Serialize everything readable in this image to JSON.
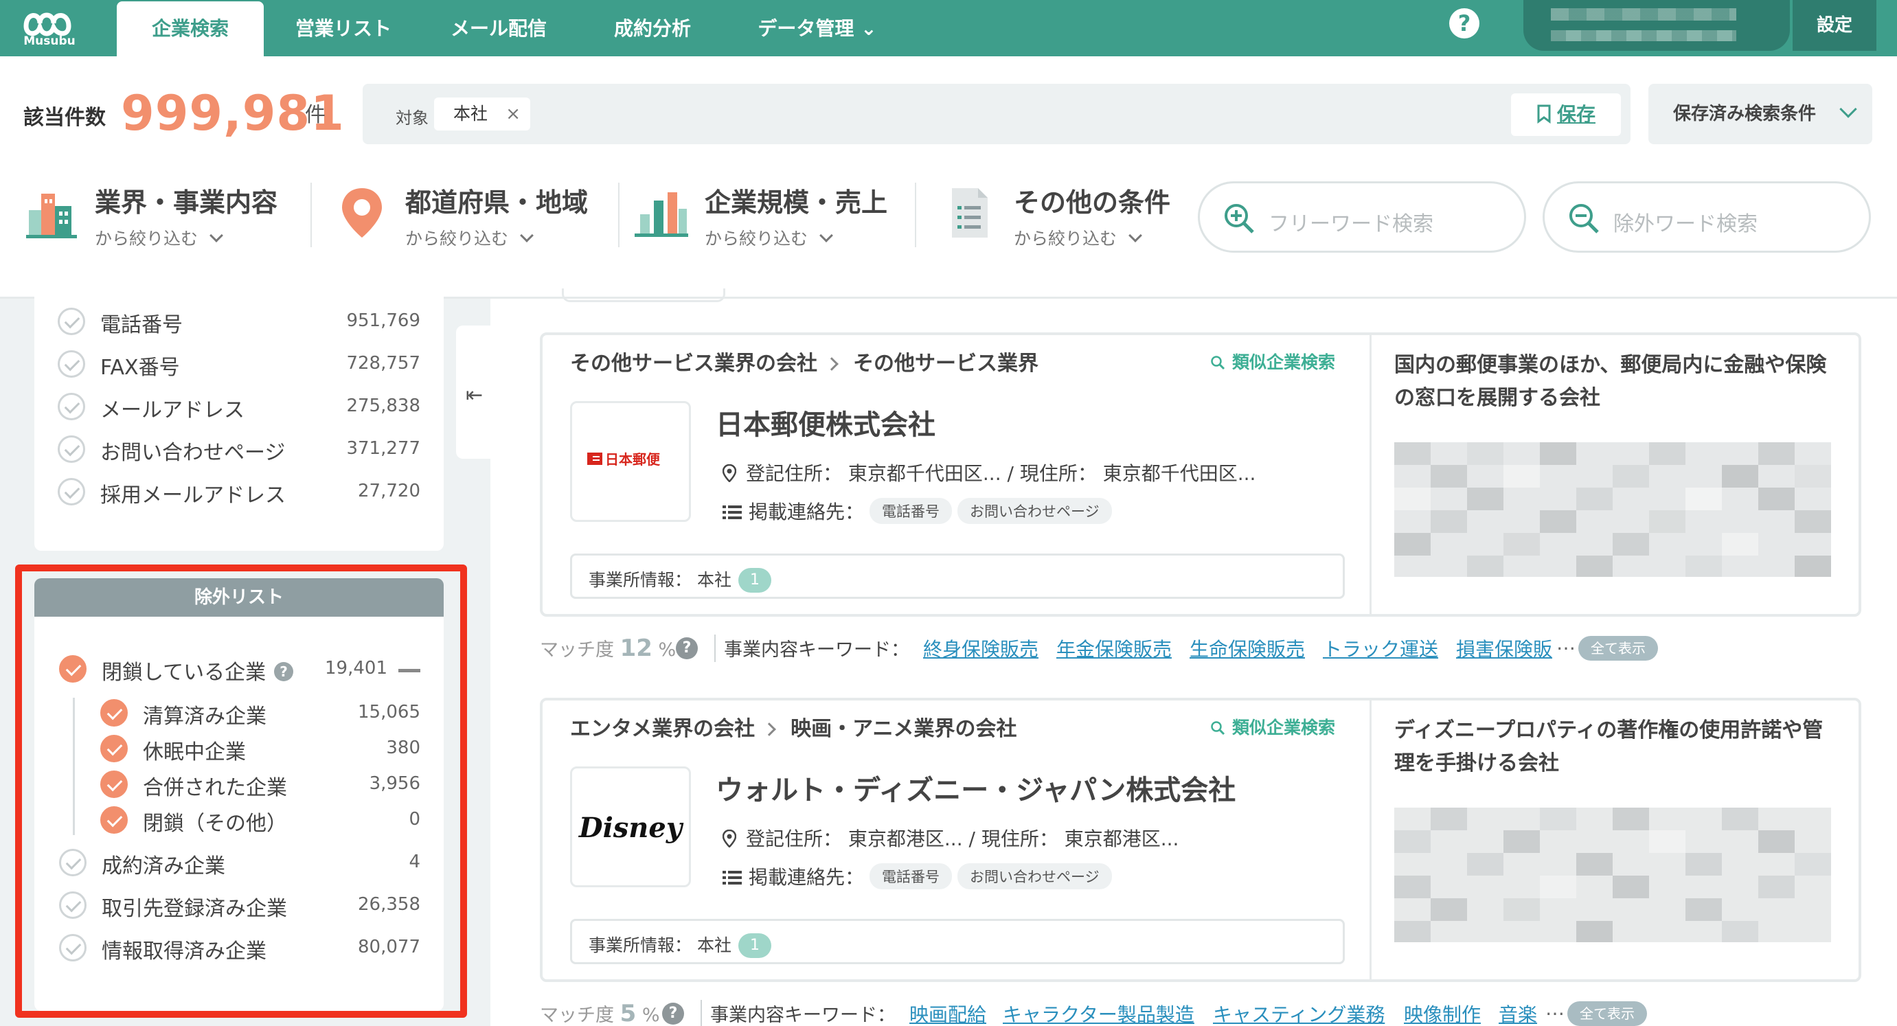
{
  "nav": {
    "logo_text": "Musubu",
    "tabs": [
      {
        "label": "企業検索",
        "active": true
      },
      {
        "label": "営業リスト"
      },
      {
        "label": "メール配信"
      },
      {
        "label": "成約分析"
      },
      {
        "label": "データ管理 ⌄"
      }
    ],
    "help": "?",
    "settings": "設定"
  },
  "summary": {
    "count_label": "該当件数",
    "count": "999,981",
    "unit": "件",
    "target_label": "対象",
    "chip": "本社",
    "chip_remove": "×",
    "save": "保存",
    "saved_conditions": "保存済み検索条件"
  },
  "filters": [
    {
      "title": "業界・事業内容",
      "sub": "から絞り込む"
    },
    {
      "title": "都道府県・地域",
      "sub": "から絞り込む"
    },
    {
      "title": "企業規模・売上",
      "sub": "から絞り込む"
    },
    {
      "title": "その他の条件",
      "sub": "から絞り込む"
    }
  ],
  "search": {
    "freeword": "フリーワード検索",
    "exclude": "除外ワード検索"
  },
  "contact_filters": [
    {
      "label": "電話番号",
      "count": "951,769"
    },
    {
      "label": "FAX番号",
      "count": "728,757"
    },
    {
      "label": "メールアドレス",
      "count": "275,838"
    },
    {
      "label": "お問い合わせページ",
      "count": "371,277"
    },
    {
      "label": "採用メールアドレス",
      "count": "27,720"
    }
  ],
  "exclude_list": {
    "title": "除外リスト",
    "closed": {
      "label": "閉鎖している企業",
      "count": "19,401",
      "help": "?"
    },
    "children": [
      {
        "label": "清算済み企業",
        "count": "15,065"
      },
      {
        "label": "休眠中企業",
        "count": "380"
      },
      {
        "label": "合併された企業",
        "count": "3,956"
      },
      {
        "label": "閉鎖（その他）",
        "count": "0"
      }
    ],
    "others": [
      {
        "label": "成約済み企業",
        "count": "4"
      },
      {
        "label": "取引先登録済み企業",
        "count": "26,358"
      },
      {
        "label": "情報取得済み企業",
        "count": "80,077"
      }
    ]
  },
  "collapse_arrow": "⇤",
  "results": [
    {
      "crumb1": "その他サービス業界の会社",
      "crumb2": "その他サービス業界",
      "similar": "類似企業検索",
      "logo_text": "日本郵便",
      "name": "日本郵便株式会社",
      "address": "登記住所： 東京都千代田区... / 現住所： 東京都千代田区...",
      "contacts_label": "掲載連絡先：",
      "tags": [
        "電話番号",
        "お問い合わせページ"
      ],
      "office_label": "事業所情報：  本社",
      "office_count": "1",
      "description": "国内の郵便事業のほか、郵便局内に金融や保険の窓口を展開する会社",
      "match_label": "マッチ度",
      "match_value": "12",
      "match_unit": "%",
      "keyword_label": "事業内容キーワード：",
      "keywords": [
        "終身保険販売",
        "年金保険販売",
        "生命保険販売",
        "トラック運送",
        "損害保険販"
      ],
      "more": "…",
      "show_all": "全て表示"
    },
    {
      "crumb1": "エンタメ業界の会社",
      "crumb2": "映画・アニメ業界の会社",
      "similar": "類似企業検索",
      "logo_text": "Disney",
      "name": "ウォルト・ディズニー・ジャパン株式会社",
      "address": "登記住所： 東京都港区... / 現住所： 東京都港区...",
      "contacts_label": "掲載連絡先：",
      "tags": [
        "電話番号",
        "お問い合わせページ"
      ],
      "office_label": "事業所情報：  本社",
      "office_count": "1",
      "description": "ディズニープロパティの著作権の使用許諾や管理を手掛ける会社",
      "match_label": "マッチ度",
      "match_value": "5",
      "match_unit": "%",
      "keyword_label": "事業内容キーワード：",
      "keywords": [
        "映画配給",
        "キャラクター製品製造",
        "キャスティング業務",
        "映像制作",
        "音楽"
      ],
      "more": "…",
      "show_all": "全て表示"
    }
  ],
  "colors": {
    "brand": "#3e9e8b",
    "accent": "#f28f6d",
    "highlight": "#f0321e",
    "link": "#2a8fbd"
  }
}
